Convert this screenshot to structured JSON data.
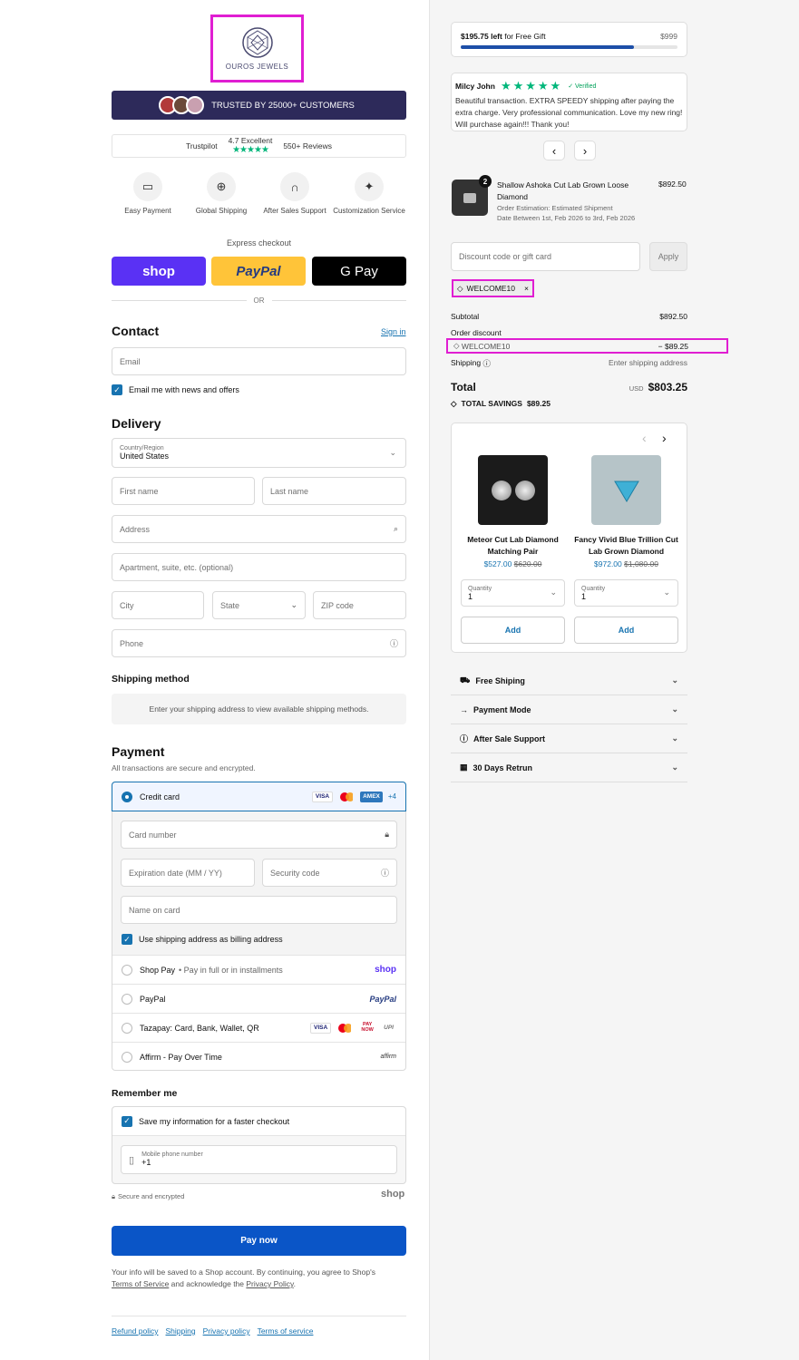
{
  "brand": {
    "name": "OUROS JEWELS",
    "highlight_color": "#e01ed2"
  },
  "trust_banner": {
    "label": "TRUSTED BY 25000+ CUSTOMERS"
  },
  "trustpilot": {
    "name": "Trustpilot",
    "rating": "4.7 Excellent",
    "stars": "★★★★★",
    "reviews": "550+ Reviews"
  },
  "features": [
    {
      "label": "Easy Payment",
      "icon": "card-icon"
    },
    {
      "label": "Global Shipping",
      "icon": "globe-icon"
    },
    {
      "label": "After Sales Support",
      "icon": "headphones-icon"
    },
    {
      "label": "Customization Service",
      "icon": "sparkle-icon"
    }
  ],
  "express": {
    "label": "Express checkout",
    "shop": "shop",
    "paypal": "PayPal",
    "gpay": "G Pay",
    "or": "OR"
  },
  "contact": {
    "title": "Contact",
    "sign_in": "Sign in",
    "email_placeholder": "Email",
    "news_label": "Email me with news and offers"
  },
  "delivery": {
    "title": "Delivery",
    "country_label": "Country/Region",
    "country_value": "United States",
    "first_name": "First name",
    "last_name": "Last name",
    "address": "Address",
    "apartment": "Apartment, suite, etc. (optional)",
    "city": "City",
    "state": "State",
    "zip": "ZIP code",
    "phone": "Phone"
  },
  "shipping_method": {
    "title": "Shipping method",
    "message": "Enter your shipping address to view available shipping methods."
  },
  "payment": {
    "title": "Payment",
    "subtitle": "All transactions are secure and encrypted.",
    "credit_card": "Credit card",
    "more": "+4",
    "card_number": "Card number",
    "expiration": "Expiration date (MM / YY)",
    "security": "Security code",
    "name_on_card": "Name on card",
    "billing_same": "Use shipping address as billing address",
    "shop_pay": "Shop Pay",
    "shop_pay_sub": "• Pay in full or in installments",
    "shop_logo": "shop",
    "paypal": "PayPal",
    "tazapay": "Tazapay: Card, Bank, Wallet, QR",
    "affirm": "Affirm - Pay Over Time",
    "affirm_logo": "affirm",
    "visa": "VISA",
    "amex": "AMEX",
    "paynow": "PAY NOW",
    "upi": "UPI"
  },
  "remember": {
    "title": "Remember me",
    "save_label": "Save my information for a faster checkout",
    "phone_label": "Mobile phone number",
    "phone_value": "+1",
    "secure": "Secure and encrypted",
    "shop_logo": "shop"
  },
  "pay_now": "Pay now",
  "legal": {
    "text1": "Your info will be saved to a Shop account. By continuing, you agree to Shop's",
    "terms": "Terms of Service",
    "text2": "and acknowledge the",
    "privacy": "Privacy Policy",
    "end": "."
  },
  "footer_links": [
    "Refund policy",
    "Shipping",
    "Privacy policy",
    "Terms of service"
  ],
  "gift": {
    "left_amount": "$195.75 left",
    "left_text": "for Free Gift",
    "goal": "$999",
    "progress": 0.8
  },
  "review": {
    "name": "Milcy John",
    "stars": "★★★★★",
    "verified": "✓ Verified",
    "text": "Beautiful transaction. EXTRA SPEEDY shipping after paying the extra charge. Very professional communication. Love my new ring! Will purchase again!!! Thank you!",
    "prev": "‹",
    "next": "›"
  },
  "item": {
    "qty": "2",
    "name": "Shallow Ashoka Cut Lab Grown Loose Diamond",
    "estimation": "Order Estimation: Estimated Shipment",
    "dates": "Date Between 1st, Feb 2026 to 3rd, Feb 2026",
    "price": "$892.50"
  },
  "discount": {
    "placeholder": "Discount code or gift card",
    "apply": "Apply",
    "code": "WELCOME10"
  },
  "summary": {
    "subtotal_label": "Subtotal",
    "subtotal": "$892.50",
    "order_discount": "Order discount",
    "code": "WELCOME10",
    "discount": "− $89.25",
    "shipping_label": "Shipping",
    "shipping_value": "Enter shipping address",
    "total_label": "Total",
    "currency": "USD",
    "total": "$803.25",
    "savings_label": "TOTAL SAVINGS",
    "savings": "$89.25"
  },
  "upsell": [
    {
      "name": "Meteor Cut Lab Diamond Matching Pair",
      "price": "$527.00",
      "old": "$620.00",
      "qty_label": "Quantity",
      "qty": "1",
      "add": "Add"
    },
    {
      "name": "Fancy Vivid Blue Trillion Cut Lab Grown Diamond",
      "price": "$972.00",
      "old": "$1,080.00",
      "qty_label": "Quantity",
      "qty": "1",
      "add": "Add"
    }
  ],
  "accordions": [
    {
      "label": "Free Shiping",
      "icon": "truck-icon"
    },
    {
      "label": "Payment Mode",
      "icon": "arrow-icon"
    },
    {
      "label": "After Sale Support",
      "icon": "question-icon"
    },
    {
      "label": "30 Days Retrun",
      "icon": "calendar-icon"
    }
  ]
}
